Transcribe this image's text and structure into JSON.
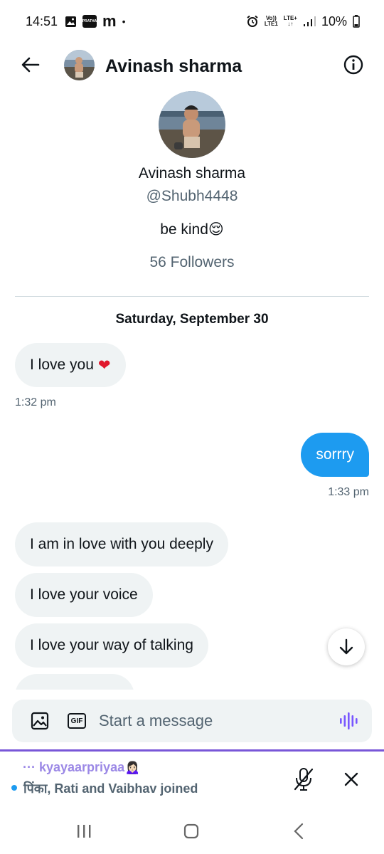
{
  "status_bar": {
    "time": "14:51",
    "notification_icons": [
      "image-icon",
      "app-badge-icon",
      "m-app-icon"
    ],
    "app_badge_text": "PRATHA",
    "m_text": "m",
    "dot": "•",
    "volte_top": "Vo))",
    "volte_bottom": "LTE1",
    "lte_top": "LTE+",
    "lte_bottom": "↓↑",
    "battery": "10%"
  },
  "header": {
    "title": "Avinash sharma"
  },
  "profile": {
    "name": "Avinash sharma",
    "handle": "@Shubh4448",
    "bio": "be kind😌",
    "followers": "56 Followers"
  },
  "conversation": {
    "date_separator": "Saturday, September 30",
    "messages": [
      {
        "direction": "in",
        "text": "I love you",
        "emoji": "❤",
        "timestamp": "1:32 pm"
      },
      {
        "direction": "out",
        "text": "sorrry",
        "timestamp": "1:33 pm"
      },
      {
        "direction": "in",
        "text": "I am in love with you deeply"
      },
      {
        "direction": "in",
        "text": "I love your voice"
      },
      {
        "direction": "in",
        "text": "I love your way of talking"
      }
    ]
  },
  "composer": {
    "placeholder": "Start a message",
    "gif_label": "GIF"
  },
  "spaces_bar": {
    "title": "··· kyayaarpriyaa🙍🏻‍♀️",
    "subtitle": "पिंका, Rati and Vaibhav joined"
  },
  "colors": {
    "accent": "#1d9bf0",
    "bubble_in": "#eff3f4",
    "spaces_purple": "#7856d8",
    "heart": "#e0182d"
  }
}
